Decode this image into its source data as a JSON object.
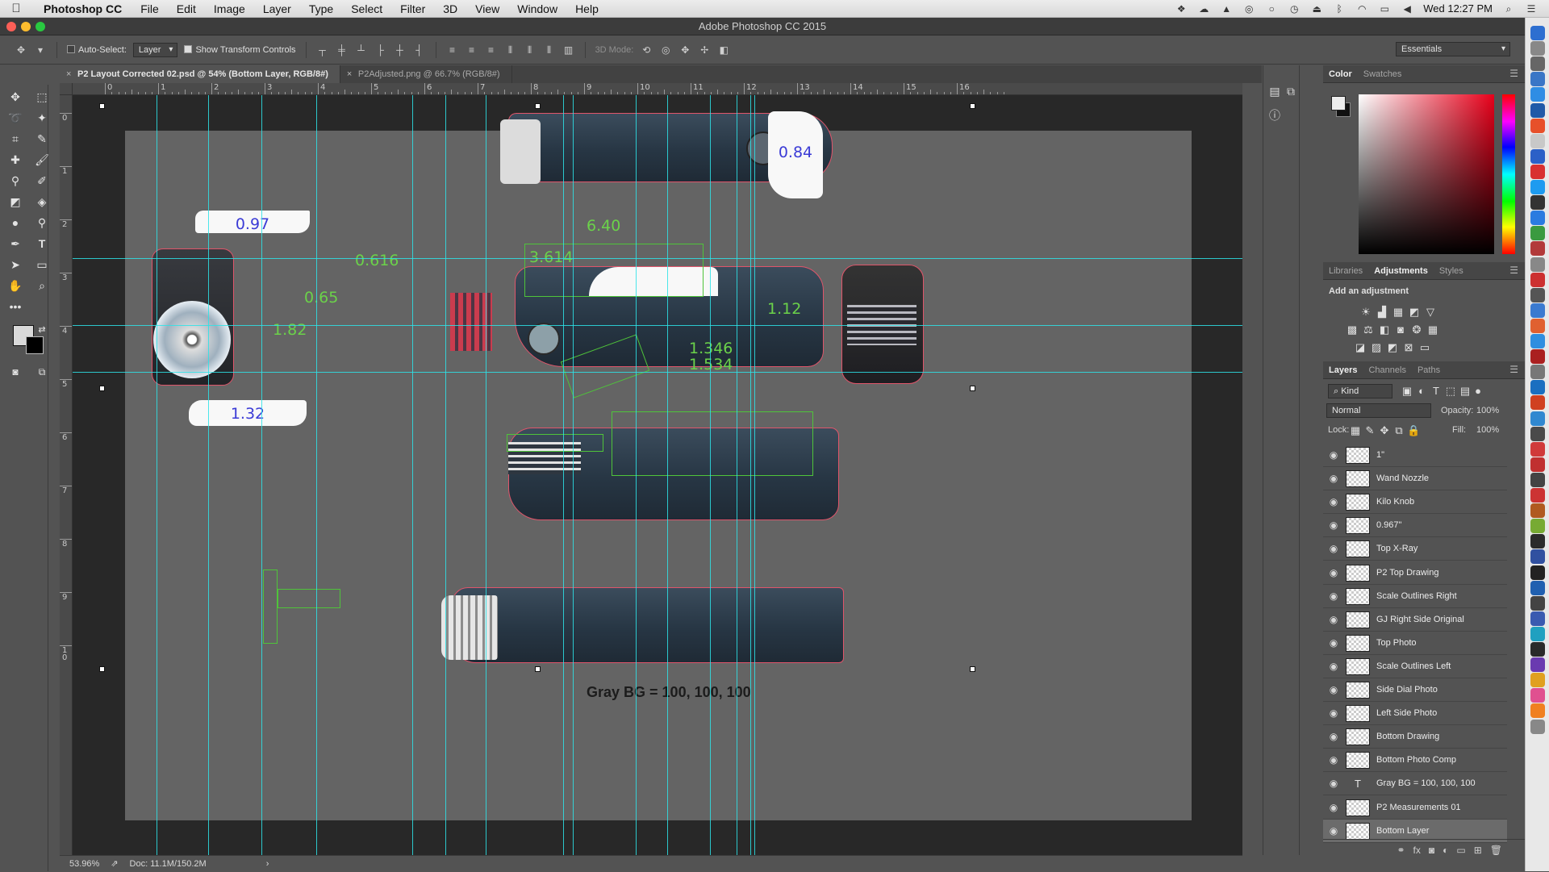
{
  "menubar": {
    "app_name": "Photoshop CC",
    "items": [
      "File",
      "Edit",
      "Image",
      "Layer",
      "Type",
      "Select",
      "Filter",
      "3D",
      "View",
      "Window",
      "Help"
    ],
    "clock": "Wed 12:27 PM"
  },
  "window": {
    "title": "Adobe Photoshop CC 2015"
  },
  "options": {
    "auto_select_label": "Auto-Select:",
    "auto_select_value": "Layer",
    "show_transform_label": "Show Transform Controls",
    "mode_3d_label": "3D Mode:",
    "workspace": "Essentials"
  },
  "doc_tabs": [
    {
      "label": "P2 Layout Corrected 02.psd @ 54% (Bottom Layer, RGB/8#)",
      "active": true
    },
    {
      "label": "P2Adjusted.png @ 66.7% (RGB/8#)",
      "active": false
    }
  ],
  "ruler_h": [
    "0",
    "1",
    "2",
    "3",
    "4",
    "5",
    "6",
    "7",
    "8",
    "9",
    "10",
    "11",
    "12",
    "13",
    "14",
    "15",
    "16"
  ],
  "ruler_v": [
    "0",
    "1",
    "2",
    "3",
    "4",
    "5",
    "6",
    "7",
    "8",
    "9",
    "1 0"
  ],
  "canvas": {
    "dims_green": [
      "6.40",
      "3.614",
      "0.616",
      "0.65",
      "1.82",
      "1.12",
      "1.346",
      "1.534"
    ],
    "dims_blue": [
      "0.97",
      "1.32",
      "0.84"
    ],
    "gray_bg_text": "Gray BG = 100, 100, 100"
  },
  "status": {
    "zoom": "53.96%",
    "doc": "Doc: 11.1M/150.2M"
  },
  "color_panel": {
    "tabs": [
      "Color",
      "Swatches"
    ]
  },
  "adjust_panel": {
    "tabs": [
      "Libraries",
      "Adjustments",
      "Styles"
    ],
    "title": "Add an adjustment"
  },
  "layers_panel": {
    "tabs": [
      "Layers",
      "Channels",
      "Paths"
    ],
    "filter_kind": "Kind",
    "blend_mode": "Normal",
    "opacity_label": "Opacity:",
    "opacity_value": "100%",
    "lock_label": "Lock:",
    "fill_label": "Fill:",
    "fill_value": "100%",
    "layers": [
      {
        "name": "1\"",
        "type": "pixel"
      },
      {
        "name": "Wand Nozzle",
        "type": "pixel"
      },
      {
        "name": "Kilo Knob",
        "type": "pixel"
      },
      {
        "name": "0.967\"",
        "type": "pixel"
      },
      {
        "name": "Top X-Ray",
        "type": "pixel"
      },
      {
        "name": "P2 Top Drawing",
        "type": "pixel"
      },
      {
        "name": "Scale Outlines Right",
        "type": "pixel"
      },
      {
        "name": "GJ Right Side Original",
        "type": "pixel"
      },
      {
        "name": "Top Photo",
        "type": "pixel"
      },
      {
        "name": "Scale Outlines Left",
        "type": "pixel"
      },
      {
        "name": "Side Dial Photo",
        "type": "pixel"
      },
      {
        "name": "Left Side Photo",
        "type": "pixel"
      },
      {
        "name": "Bottom Drawing",
        "type": "pixel"
      },
      {
        "name": "Bottom Photo Comp",
        "type": "pixel"
      },
      {
        "name": "Gray BG = 100, 100, 100",
        "type": "text"
      },
      {
        "name": "P2 Measurements 01",
        "type": "pixel"
      },
      {
        "name": "Bottom Layer",
        "type": "pixel",
        "selected": true
      }
    ]
  }
}
